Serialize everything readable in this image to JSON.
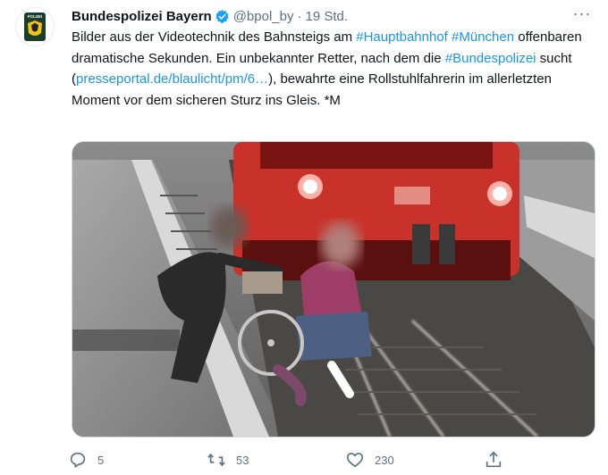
{
  "tweet": {
    "author_name": "Bundespolizei Bayern",
    "handle": "@bpol_by",
    "separator": "·",
    "time": "19 Std.",
    "avatar_label": "POLIZEI",
    "more_label": "···",
    "text": {
      "t1": "Bilder aus der Videotechnik des Bahnsteigs am ",
      "hashtag1": "#Hauptbahnhof",
      "t2": " ",
      "hashtag2": "#München",
      "t3": " offenbaren dramatische Sekunden. Ein unbekannter Retter, nach dem die ",
      "hashtag3": "#Bundespolizei",
      "t4": " sucht (",
      "link": "presseportal.de/blaulicht/pm/6…",
      "t5": "), bewahrte eine Rollstuhlfahrerin im allerletzten Moment vor dem sicheren Sturz ins Gleis. *M"
    },
    "actions": {
      "reply": {
        "icon": "reply-icon",
        "count": "5"
      },
      "retweet": {
        "icon": "retweet-icon",
        "count": "53"
      },
      "like": {
        "icon": "heart-icon",
        "count": "230"
      },
      "share": {
        "icon": "share-icon"
      }
    },
    "colors": {
      "link": "#1b95e0",
      "secondary": "#5b7083",
      "verified": "#1da1f2"
    }
  }
}
